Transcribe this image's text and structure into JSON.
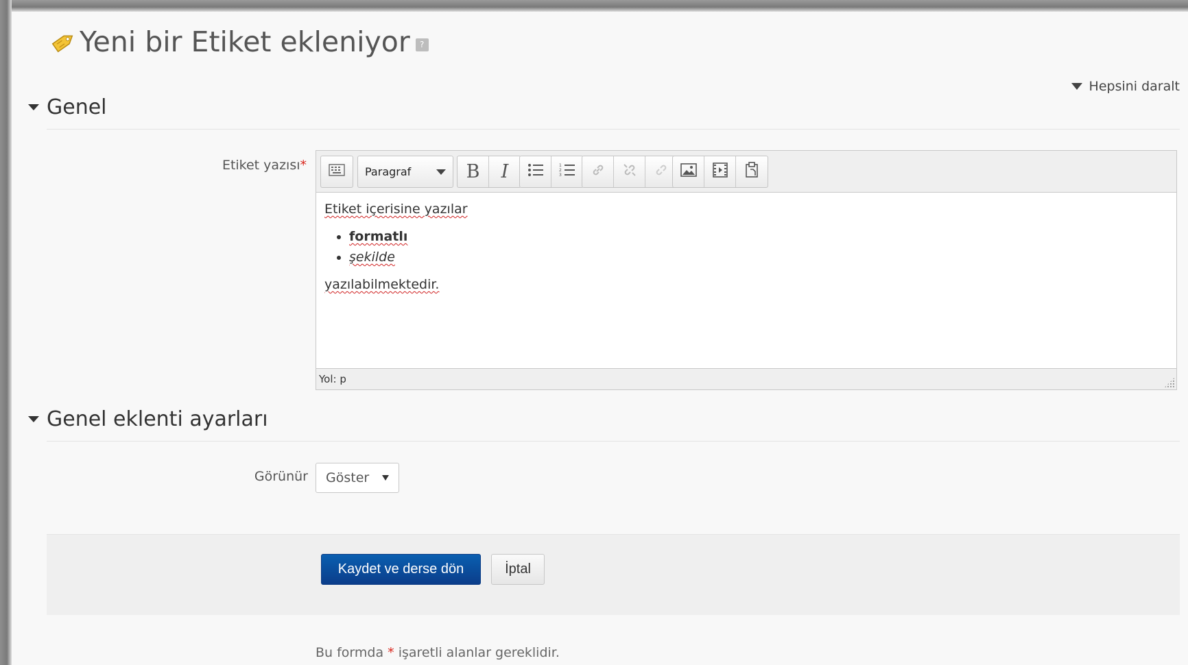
{
  "page": {
    "title": "Yeni bir Etiket ekleniyor",
    "help_glyph": "?",
    "collapse_all": "Hepsini daralt"
  },
  "sections": {
    "general": "Genel",
    "module_settings": "Genel eklenti ayarları"
  },
  "form": {
    "label_text_field": "Etiket yazısı",
    "required_marker": "*",
    "visible_label": "Görünür",
    "visible_value": "Göster"
  },
  "editor": {
    "paragraph_select": "Paragraf",
    "bold_glyph": "B",
    "italic_glyph": "I",
    "content": {
      "line1": "Etiket içerisine yazılar",
      "bullets": [
        "formatlı",
        "şekilde"
      ],
      "line2": "yazılabilmektedir."
    },
    "path": "Yol: p"
  },
  "buttons": {
    "save": "Kaydet ve derse dön",
    "cancel": "İptal"
  },
  "footer": {
    "note_before": "Bu formda",
    "note_marker": "*",
    "note_after": "işaretli alanlar gereklidir."
  },
  "colors": {
    "primary": "#0b4f9e",
    "required": "#d9261c",
    "background": "#f8f8f8"
  },
  "icons": [
    "tag-icon",
    "help-icon",
    "toolbar-toggle-icon",
    "bullet-list-icon",
    "numbered-list-icon",
    "link-icon",
    "unlink-icon",
    "anchor-icon",
    "image-icon",
    "media-icon",
    "paste-icon"
  ]
}
